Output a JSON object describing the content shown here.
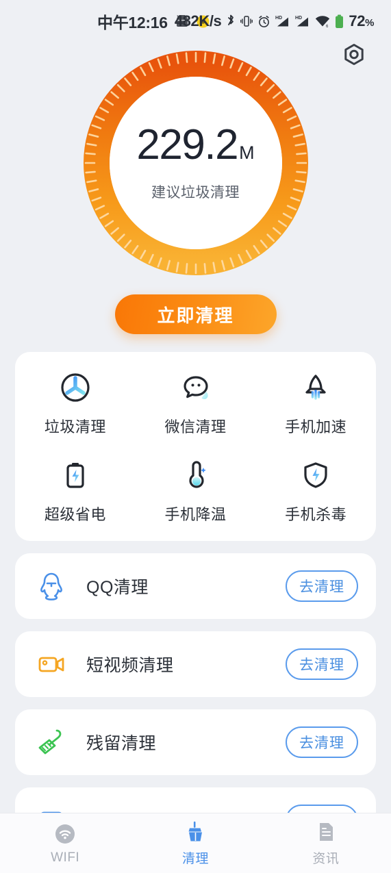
{
  "status_bar": {
    "time": "中午12:16",
    "left_icons": [
      "android-robot-icon",
      "sun-badge-icon"
    ],
    "network_speed": "482K/s",
    "right_icons": [
      "bluetooth-icon",
      "vibrate-icon",
      "alarm-icon",
      "signal-hd-1-icon",
      "signal-hd-2-icon",
      "wifi-icon"
    ],
    "battery_percent": "72",
    "battery_percent_symbol": "%"
  },
  "header": {
    "settings_icon": "hex-gear-icon"
  },
  "gauge": {
    "value": "229.2",
    "unit": "M",
    "subtitle": "建议垃圾清理",
    "ring_color_top": "#e8540c",
    "ring_color_bottom": "#f7a91f",
    "tick_color": "#ffd9a0",
    "tick_count": 72
  },
  "primary_action": {
    "label": "立即清理",
    "gradient_from": "#f97707",
    "gradient_to": "#fca62a"
  },
  "feature_grid": {
    "rows": [
      [
        {
          "label": "垃圾清理",
          "icon": "fan-circle-icon"
        },
        {
          "label": "微信清理",
          "icon": "wechat-bubble-icon"
        },
        {
          "label": "手机加速",
          "icon": "rocket-icon"
        }
      ],
      [
        {
          "label": "超级省电",
          "icon": "battery-bolt-icon"
        },
        {
          "label": "手机降温",
          "icon": "thermometer-icon"
        },
        {
          "label": "手机杀毒",
          "icon": "shield-bolt-icon"
        }
      ]
    ]
  },
  "clean_list": {
    "button_label": "去清理",
    "items": [
      {
        "label": "QQ清理",
        "icon": "qq-penguin-icon",
        "icon_color": "#4a90e8"
      },
      {
        "label": "短视频清理",
        "icon": "video-camera-icon",
        "icon_color": "#f5a623"
      },
      {
        "label": "残留清理",
        "icon": "broom-green-icon",
        "icon_color": "#3cc452"
      }
    ]
  },
  "bottom_nav": {
    "active_color": "#4a90e8",
    "inactive_color": "#a9aeb7",
    "items": [
      {
        "label": "WIFI",
        "icon": "wifi-nav-icon",
        "active": false
      },
      {
        "label": "清理",
        "icon": "broom-nav-icon",
        "active": true
      },
      {
        "label": "资讯",
        "icon": "news-doc-icon",
        "active": false
      }
    ]
  }
}
